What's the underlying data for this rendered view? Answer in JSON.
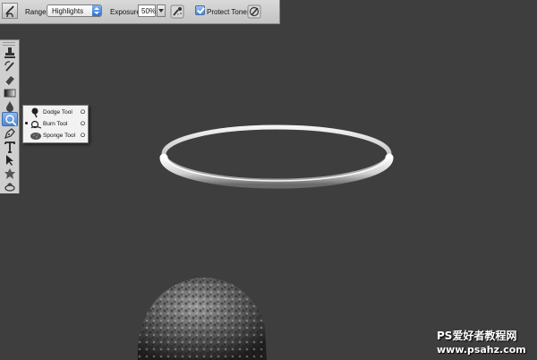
{
  "options_bar": {
    "tool_icon": "burn-tool-icon",
    "range_label": "Range:",
    "range_value": "Highlights",
    "exposure_label": "Exposure:",
    "exposure_value": "50%",
    "airbrush_icon": "airbrush-icon",
    "protect_tones_label": "Protect Tones",
    "protect_tones_checked": true,
    "tablet_pressure_icon": "tablet-pressure-icon"
  },
  "toolbox": {
    "tools": [
      {
        "name": "stamp-tool",
        "icon": "stamp-icon"
      },
      {
        "name": "history-brush-tool",
        "icon": "history-brush-icon"
      },
      {
        "name": "eraser-tool",
        "icon": "eraser-icon"
      },
      {
        "name": "gradient-tool",
        "icon": "gradient-icon"
      },
      {
        "name": "blur-tool",
        "icon": "drop-icon"
      },
      {
        "name": "burn-tool",
        "icon": "burn-icon",
        "active": true
      },
      {
        "name": "pen-tool",
        "icon": "pen-icon"
      },
      {
        "name": "type-tool",
        "icon": "type-icon"
      },
      {
        "name": "path-selection-tool",
        "icon": "arrow-icon"
      },
      {
        "name": "shape-tool",
        "icon": "shape-icon"
      },
      {
        "name": "3d-tool",
        "icon": "3d-rotate-icon"
      }
    ]
  },
  "flyout": {
    "items": [
      {
        "label": "Dodge Tool",
        "shortcut": "O",
        "selected": false
      },
      {
        "label": "Burn Tool",
        "shortcut": "O",
        "selected": true
      },
      {
        "label": "Sponge Tool",
        "shortcut": "O",
        "selected": false
      }
    ]
  },
  "canvas": {
    "background_color": "#3e3e3e",
    "objects": [
      "halo-ring",
      "head"
    ]
  },
  "watermark": {
    "line1": "PS爱好者教程网",
    "line2": "www.psahz.com"
  }
}
